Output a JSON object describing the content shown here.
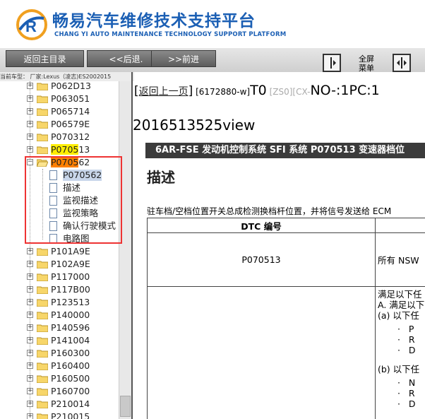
{
  "header": {
    "title": "畅易汽车维修技术支持平台",
    "subtitle": "CHANG YI AUTO MAINTENANCE TECHNOLOGY SUPPORT PLATFORM",
    "logo_letter": "R"
  },
  "toolbar": {
    "home": "返回主目录",
    "back": "<<后退.",
    "forward": ">>前进",
    "fullscreen": "全屏 菜单"
  },
  "model_bar": "当前车型：  厂家:Lexus（凌志)ES2002015",
  "tree": {
    "items": [
      {
        "label": "P062D13"
      },
      {
        "label": "P063051"
      },
      {
        "label": "P065714"
      },
      {
        "label": "P06579E"
      },
      {
        "label": "P070312"
      },
      {
        "label_hl": "P0705",
        "label_rest": "13"
      },
      {
        "label_hl": "P0705",
        "label_rest": "62"
      }
    ],
    "children": [
      "P070562",
      "描述",
      "监视描述",
      "监视策略",
      "确认行驶模式",
      "电路图"
    ],
    "items_after": [
      "P101A9E",
      "P102A9E",
      "P117000",
      "P117B00",
      "P123513",
      "P140000",
      "P140596",
      "P141004",
      "P160300",
      "P160400",
      "P160500",
      "P160700",
      "P210014",
      "P210015"
    ]
  },
  "content": {
    "back_link": "返回上一页",
    "code": "[6172880-w]",
    "t0": "T0",
    "zs": "[ZS0][CX-",
    "no": "NO-:1PC:1",
    "view": "2016513525view",
    "bar": "6AR-FSE 发动机控制系统  SFI 系统  P070513 变速器档位",
    "heading": "描述",
    "para": "驻车档/空档位置开关总成检测换档杆位置，并将信号发送给 ECM",
    "table": {
      "col1": "DTC 编号",
      "dtc": "P070513",
      "side": "所有 NSW",
      "cond": [
        "满足以下任",
        "A. 满足以下",
        "(a) 以下任"
      ],
      "b1": [
        "P",
        "R",
        "D"
      ],
      "cond_b": "(b) 以下任",
      "b2": [
        "N",
        "R",
        "D"
      ]
    }
  }
}
